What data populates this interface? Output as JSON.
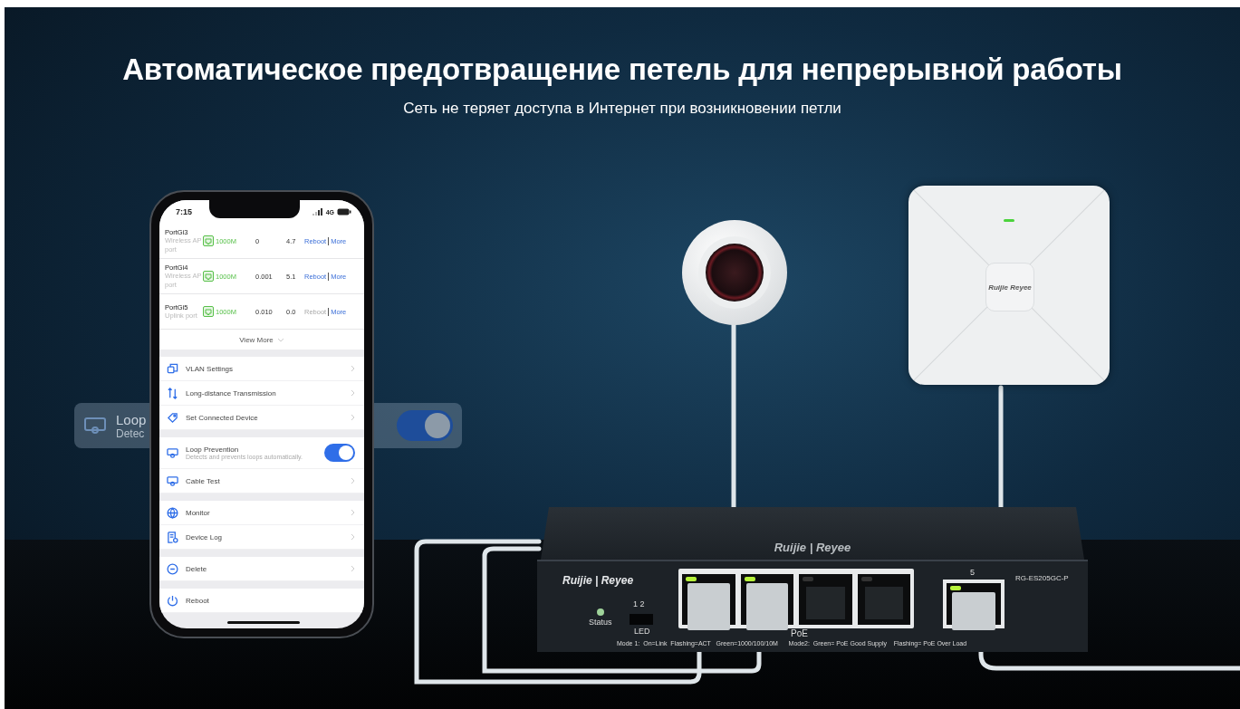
{
  "headline": "Автоматическое предотвращение петель для непрерывной работы",
  "subheadline": "Сеть не теряет доступа в Интернет при возникновении петли",
  "overlay_card": {
    "title": "Loop",
    "description": "Detec",
    "on": true
  },
  "phone": {
    "time": "7:15",
    "network": "4G",
    "ports": [
      {
        "name": "PortGi3",
        "role": "Wireless AP port",
        "speed": "1000M",
        "column_3": "0",
        "column_4": "4.7",
        "reboot": "Reboot",
        "reboot_disabled": false,
        "more": "More"
      },
      {
        "name": "PortGi4",
        "role": "Wireless AP port",
        "speed": "1000M",
        "column_3": "0.001",
        "column_4": "5.1",
        "reboot": "Reboot",
        "reboot_disabled": false,
        "more": "More"
      },
      {
        "name": "PortGi5",
        "role": "Uplink port",
        "speed": "1000M",
        "column_3": "0.010",
        "column_4": "0.0",
        "reboot": "Reboot",
        "reboot_disabled": true,
        "more": "More"
      }
    ],
    "view_more": "View More",
    "menu_groups": [
      [
        {
          "kind": "link",
          "label": "VLAN Settings"
        },
        {
          "kind": "link",
          "label": "Long-distance Transmission"
        },
        {
          "kind": "link",
          "label": "Set Connected Device"
        }
      ],
      [
        {
          "kind": "toggle",
          "label": "Loop Prevention",
          "description": "Detects and prevents loops automatically.",
          "on": true
        },
        {
          "kind": "link",
          "label": "Cable Test"
        }
      ],
      [
        {
          "kind": "link",
          "label": "Monitor"
        },
        {
          "kind": "link",
          "label": "Device Log"
        }
      ],
      [
        {
          "kind": "link",
          "label": "Delete"
        }
      ],
      [
        {
          "kind": "action",
          "label": "Reboot"
        }
      ]
    ]
  },
  "access_point": {
    "logo": "Ruijie Reyee"
  },
  "switch": {
    "top_logo": "Ruijie | Reyee",
    "front_logo": "Ruijie | Reyee",
    "status_label": "Status",
    "led_numbers": "1 2",
    "led_label": "LED",
    "poe_label": "PoE",
    "port_5_label": "5",
    "model": "RG-ES205GC-P",
    "legend": "Mode 1:  On=Link  Flashing=ACT   Green=1000/100/10M      Mode2:  Green= PoE Good Supply    Flashing= PoE Over Load",
    "ports": [
      {
        "link": true
      },
      {
        "link": true
      },
      {
        "link": false
      },
      {
        "link": false
      },
      {
        "link": true
      }
    ]
  }
}
